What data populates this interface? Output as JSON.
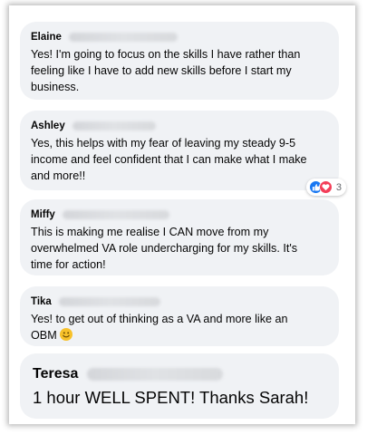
{
  "comments": [
    {
      "name": "Elaine",
      "text": "Yes! I'm going to focus on the skills I have rather than\nfeeling like I have to add new skills before I start my\nbusiness."
    },
    {
      "name": "Ashley",
      "text": "Yes, this helps with my fear of leaving my steady 9-5\nincome and feel confident that I can make what I make\nand more!!",
      "reactions": {
        "icons": [
          "like-icon",
          "love-icon"
        ],
        "count": "3",
        "colors": {
          "like": "#1877f2",
          "love": "#f33e58"
        }
      }
    },
    {
      "name": "Miffy",
      "text": "This is making me realise I CAN move from my\noverwhelmed VA role undercharging for my skills. It's\ntime for action!"
    },
    {
      "name": "Tika",
      "text": "Yes! to get out of thinking as a VA and more like an\nOBM",
      "emoji": "smiling-face-emoji"
    },
    {
      "name": "Teresa",
      "text": "1 hour WELL SPENT! Thanks Sarah!"
    }
  ],
  "theme": {
    "bubble_bg": "#f0f2f5",
    "text_color": "#050505"
  }
}
